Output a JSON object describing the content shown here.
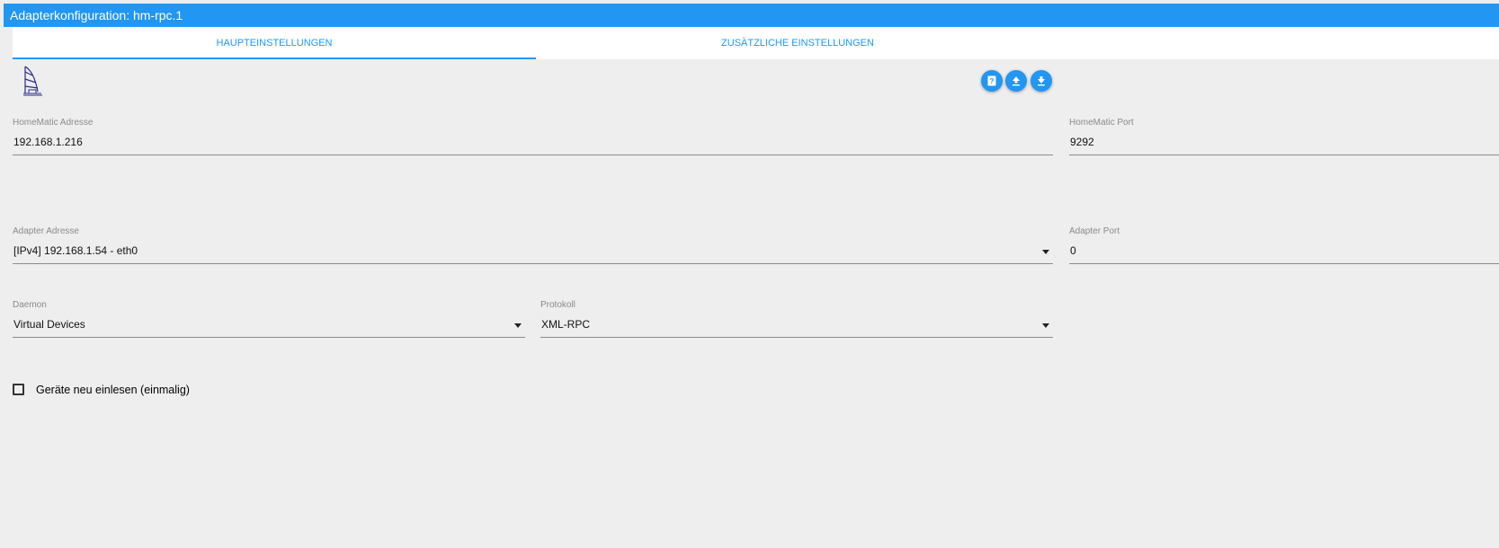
{
  "window": {
    "title": "Adapterkonfiguration: hm-rpc.1"
  },
  "tabs": [
    {
      "label": "HAUPTEINSTELLUNGEN",
      "active": true
    },
    {
      "label": "ZUSÄTZLICHE EINSTELLUNGEN",
      "active": false
    }
  ],
  "toolbar": {
    "icons": [
      "help-icon",
      "upload-icon",
      "download-icon"
    ],
    "accent_color": "#2196f3"
  },
  "fields": {
    "homematic_address": {
      "label": "HomeMatic Adresse",
      "value": "192.168.1.216"
    },
    "homematic_port": {
      "label": "HomeMatic Port",
      "value": "9292"
    },
    "adapter_address": {
      "label": "Adapter Adresse",
      "value": "[IPv4] 192.168.1.54 - eth0"
    },
    "adapter_port": {
      "label": "Adapter Port",
      "value": "0"
    },
    "daemon": {
      "label": "Daemon",
      "value": "Virtual Devices"
    },
    "protocol": {
      "label": "Protokoll",
      "value": "XML-RPC"
    }
  },
  "checkbox": {
    "label": "Geräte neu einlesen (einmalig)",
    "checked": false
  }
}
